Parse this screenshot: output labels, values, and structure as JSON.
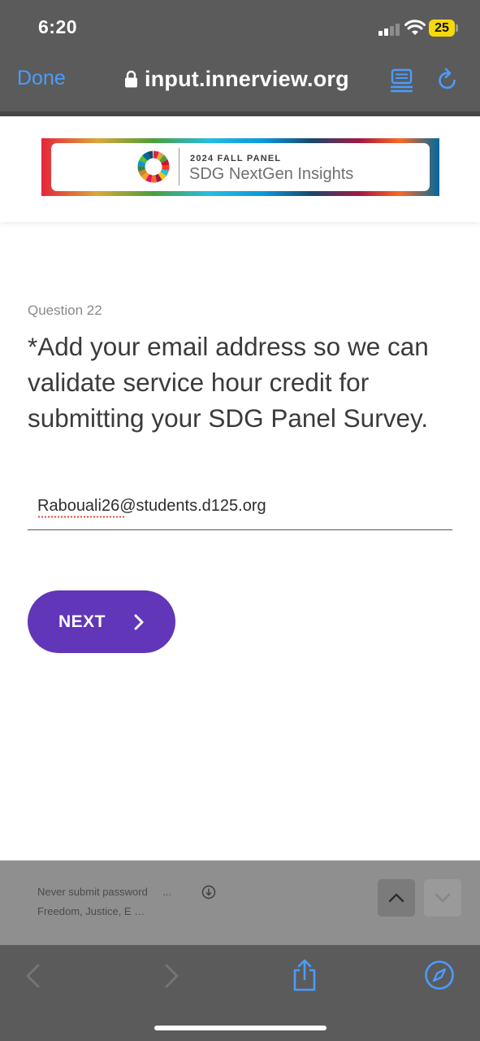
{
  "status_bar": {
    "time": "6:20",
    "battery_level": "25",
    "icons": [
      "signal-icon",
      "wifi-icon",
      "battery-icon"
    ]
  },
  "browser": {
    "done_label": "Done",
    "url": "input.innerview.org",
    "icons": [
      "lock-icon",
      "reader-icon",
      "reload-icon"
    ],
    "accent_color": "#4a9cff"
  },
  "banner": {
    "kicker": "2024 FALL PANEL",
    "title": "SDG NextGen Insights"
  },
  "question": {
    "number_label": "Question 22",
    "text": "*Add your email address so we can validate service hour credit for submitting your SDG Panel Survey."
  },
  "email_input": {
    "value": "Rabouali26@students.d125.org",
    "placeholder": ""
  },
  "next_button": {
    "label": "NEXT",
    "color": "#6136b8"
  },
  "autofill": {
    "line1": "Never submit password",
    "ellipsis": "...",
    "line2": "Freedom, Justice, E …",
    "icons": [
      "download-icon",
      "chevron-up-icon",
      "chevron-down-icon"
    ]
  },
  "toolbar": {
    "icons": [
      "back-icon",
      "forward-icon",
      "share-icon",
      "compass-icon"
    ]
  }
}
